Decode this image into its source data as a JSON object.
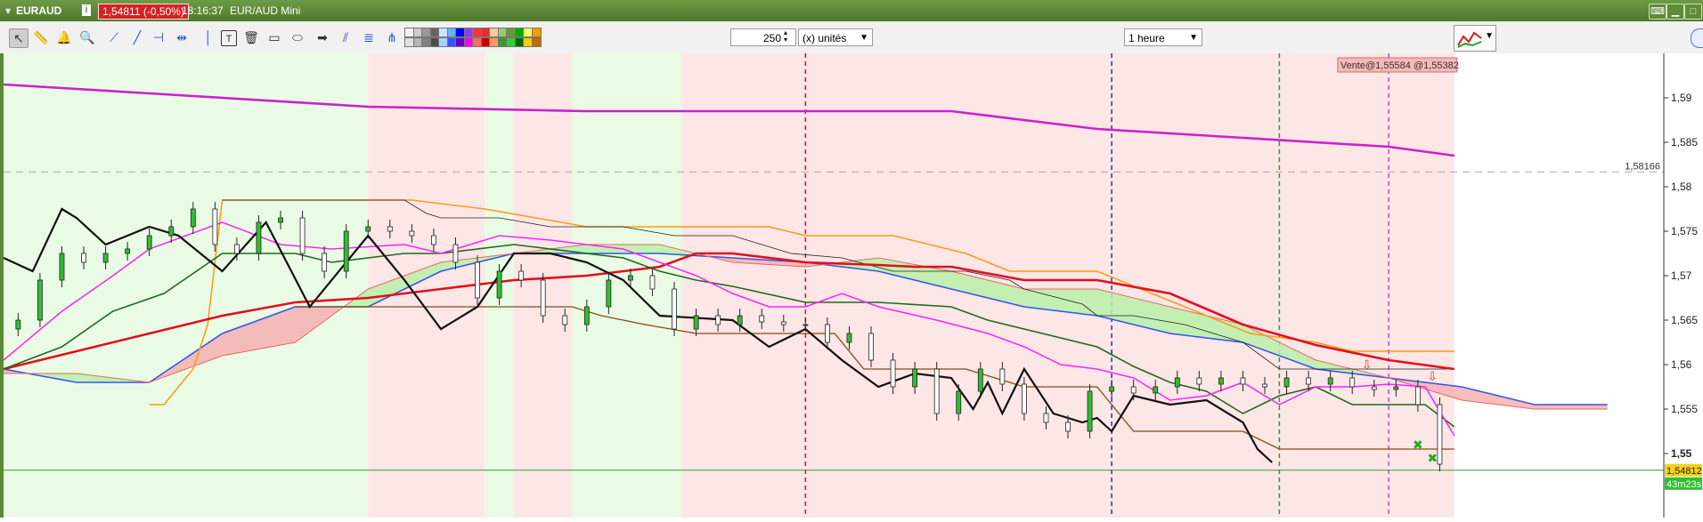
{
  "window": {
    "symbol": "EURAUD",
    "price": "1,54811 (-0,50%)",
    "time": "18:16:37",
    "name": "EUR/AUD Mini",
    "info_icon": "info-icon",
    "menu_icon": "chevron-down-icon"
  },
  "toolbar": {
    "tools": [
      "pointer-icon",
      "ruler-icon",
      "alarm-icon",
      "zoom-icon",
      "trendline-icon",
      "line-icon",
      "horizontal-line-icon",
      "segment-icon",
      "vertical-line-icon",
      "text-icon",
      "trash-icon",
      "rectangle-icon",
      "ellipse-icon",
      "arrow-icon",
      "channel-icon",
      "fibonacci-icon",
      "pitchfork-icon"
    ],
    "units_value": "250",
    "units_label": "(x) unités",
    "timeframe": "1 heure",
    "colors": [
      "#f2f2f2",
      "#e0e0e0",
      "#cccccc",
      "#b3b3b3",
      "#999999",
      "#808080",
      "#666666",
      "#4d4d4d",
      "#cce5ff",
      "#a3d3ff",
      "#66b3ff",
      "#3355ff",
      "#0000ff",
      "#6600cc",
      "#9933ff",
      "#ff00ff",
      "#ff3333",
      "#ff6666",
      "#e03030",
      "#cc0000",
      "#ffcc99",
      "#ff9966",
      "#99cc66",
      "#339933",
      "#669933",
      "#33cc33",
      "#00aa00",
      "#006600",
      "#ffff66",
      "#ffcc00",
      "#ff9900",
      "#cc6600"
    ]
  },
  "chart_data": {
    "type": "line",
    "instrument": "EUR/AUD",
    "timeframe": "1 heure",
    "y_ticks": [
      1.55,
      1.555,
      1.56,
      1.565,
      1.57,
      1.575,
      1.58,
      1.585,
      1.59
    ],
    "y_tick_labels": [
      "1,55",
      "1,555",
      "1,56",
      "1,565",
      "1,57",
      "1,575",
      "1,58",
      "1,585",
      "1,59"
    ],
    "ylim": [
      1.546,
      1.595
    ],
    "x_range": [
      0,
      200
    ],
    "n_candles": 200,
    "last_price": "1,54812",
    "countdown": "43m23s",
    "reference_line": {
      "value": 1.58166,
      "label": "1,58166"
    },
    "trade_label": "Vente@1,55584 @1,55382",
    "sma_magenta": {
      "x": [
        0,
        20,
        50,
        80,
        130,
        150,
        170,
        190,
        199
      ],
      "y": [
        1.5915,
        1.5905,
        1.589,
        1.5885,
        1.5885,
        1.5865,
        1.5855,
        1.5845,
        1.5835
      ]
    },
    "tenkan_magenta": {
      "x": [
        0,
        8,
        15,
        20,
        30,
        38,
        45,
        55,
        60,
        68,
        75,
        85,
        90,
        95,
        100,
        105,
        110,
        115,
        120,
        128,
        135,
        140,
        145,
        150,
        155,
        160,
        165,
        170,
        175,
        180,
        185,
        190,
        195,
        199
      ],
      "y": [
        1.5605,
        1.566,
        1.57,
        1.573,
        1.576,
        1.5735,
        1.573,
        1.5735,
        1.5725,
        1.5745,
        1.574,
        1.573,
        1.5715,
        1.57,
        1.568,
        1.5665,
        1.5665,
        1.568,
        1.5665,
        1.565,
        1.5635,
        1.562,
        1.56,
        1.5595,
        1.5585,
        1.556,
        1.5565,
        1.558,
        1.5555,
        1.5575,
        1.5575,
        1.5578,
        1.5575,
        1.552
      ]
    },
    "kijun_green": {
      "x": [
        0,
        8,
        15,
        22,
        30,
        40,
        45,
        55,
        60,
        70,
        85,
        90,
        95,
        100,
        110,
        120,
        130,
        135,
        140,
        150,
        155,
        160,
        165,
        170,
        175,
        180,
        185,
        190,
        195,
        199
      ],
      "y": [
        1.5595,
        1.562,
        1.566,
        1.568,
        1.5725,
        1.5725,
        1.5715,
        1.5725,
        1.5725,
        1.5735,
        1.572,
        1.5705,
        1.5695,
        1.5688,
        1.567,
        1.567,
        1.5665,
        1.565,
        1.564,
        1.562,
        1.5598,
        1.558,
        1.557,
        1.5545,
        1.5565,
        1.5575,
        1.5555,
        1.5555,
        1.5555,
        1.553
      ]
    },
    "chikou_black": {
      "x": [
        0,
        4,
        8,
        10,
        14,
        20,
        24,
        30,
        36,
        42,
        50,
        55,
        60,
        65,
        70,
        75,
        80,
        85,
        90,
        100,
        105,
        110,
        115,
        120,
        125,
        130,
        133,
        135,
        137,
        140,
        144,
        148,
        150,
        152,
        155,
        160,
        165,
        170,
        172,
        174
      ],
      "y": [
        1.572,
        1.5705,
        1.5775,
        1.5765,
        1.5735,
        1.5755,
        1.5745,
        1.5705,
        1.576,
        1.5665,
        1.5745,
        1.5695,
        1.564,
        1.5665,
        1.5725,
        1.5725,
        1.5715,
        1.5695,
        1.5655,
        1.565,
        1.562,
        1.564,
        1.5605,
        1.5575,
        1.559,
        1.5585,
        1.555,
        1.558,
        1.5545,
        1.5595,
        1.5545,
        1.5535,
        1.554,
        1.5525,
        1.5565,
        1.5555,
        1.556,
        1.5535,
        1.5505,
        1.549
      ]
    },
    "red_ma": {
      "x": [
        0,
        10,
        20,
        30,
        40,
        50,
        60,
        70,
        80,
        90,
        95,
        100,
        110,
        120,
        125,
        130,
        140,
        150,
        160,
        170,
        180,
        190,
        199
      ],
      "y": [
        1.5595,
        1.5615,
        1.5635,
        1.5655,
        1.567,
        1.5675,
        1.5685,
        1.5695,
        1.57,
        1.571,
        1.5725,
        1.5725,
        1.5715,
        1.5712,
        1.571,
        1.571,
        1.5695,
        1.5695,
        1.568,
        1.5645,
        1.5622,
        1.5605,
        1.5595
      ]
    },
    "ssa_red_line": {
      "x": [
        0,
        10,
        20,
        30,
        40,
        50,
        60,
        70,
        80,
        90,
        100,
        110,
        120,
        130,
        140,
        150,
        160,
        170,
        180,
        190,
        200,
        210,
        220
      ],
      "y": [
        1.559,
        1.559,
        1.558,
        1.561,
        1.5625,
        1.5685,
        1.5715,
        1.5725,
        1.5735,
        1.5735,
        1.5715,
        1.571,
        1.572,
        1.5705,
        1.5685,
        1.5685,
        1.5665,
        1.5645,
        1.5605,
        1.5585,
        1.556,
        1.555,
        1.555
      ]
    },
    "ssb_blue_line": {
      "x": [
        0,
        10,
        20,
        30,
        40,
        50,
        60,
        70,
        80,
        90,
        100,
        110,
        120,
        130,
        140,
        150,
        160,
        170,
        180,
        190,
        200,
        210,
        220
      ],
      "y": [
        1.5595,
        1.558,
        1.558,
        1.5635,
        1.5665,
        1.5665,
        1.5705,
        1.5725,
        1.5725,
        1.5725,
        1.572,
        1.5715,
        1.5705,
        1.5685,
        1.5665,
        1.5655,
        1.5635,
        1.5625,
        1.5595,
        1.5585,
        1.5575,
        1.5555,
        1.5555
      ]
    },
    "orange_line": {
      "x": [
        20,
        22,
        24,
        26,
        28,
        30,
        40,
        48,
        56,
        66,
        80,
        90,
        105,
        110,
        122,
        132,
        138,
        150,
        165,
        171,
        180,
        185,
        199
      ],
      "y": [
        1.5555,
        1.5555,
        1.5575,
        1.5595,
        1.5645,
        1.5785,
        1.5785,
        1.5785,
        1.5785,
        1.5775,
        1.5755,
        1.5755,
        1.5755,
        1.5745,
        1.5745,
        1.5725,
        1.5705,
        1.5705,
        1.5655,
        1.5635,
        1.5625,
        1.5615,
        1.5615
      ]
    },
    "black_thin": {
      "x": [
        30,
        40,
        55,
        58,
        60,
        68,
        75,
        85,
        92,
        100,
        108,
        115,
        122,
        128,
        132,
        138,
        140,
        148,
        150,
        155,
        162,
        170,
        175,
        199
      ],
      "y": [
        1.5785,
        1.5785,
        1.5785,
        1.577,
        1.5765,
        1.5765,
        1.5755,
        1.5755,
        1.5745,
        1.5745,
        1.5725,
        1.572,
        1.5705,
        1.5705,
        1.5705,
        1.5695,
        1.5685,
        1.5668,
        1.5655,
        1.5655,
        1.5645,
        1.5625,
        1.5595,
        1.5595
      ]
    },
    "brown_line": {
      "x": [
        40,
        70,
        78,
        82,
        88,
        95,
        100,
        110,
        114,
        118,
        124,
        128,
        132,
        140,
        145,
        150,
        155,
        170,
        175,
        199
      ],
      "y": [
        1.5665,
        1.5665,
        1.5665,
        1.5655,
        1.5645,
        1.5635,
        1.5635,
        1.5635,
        1.5635,
        1.5595,
        1.5595,
        1.5595,
        1.5595,
        1.5575,
        1.5575,
        1.5575,
        1.5525,
        1.5525,
        1.5505,
        1.5505
      ]
    },
    "candles": {
      "x": [
        2,
        5,
        8,
        11,
        14,
        17,
        20,
        23,
        26,
        29,
        32,
        35,
        38,
        41,
        44,
        47,
        50,
        53,
        56,
        59,
        62,
        65,
        68,
        71,
        74,
        77,
        80,
        83,
        86,
        89,
        92,
        95,
        98,
        101,
        104,
        107,
        110,
        113,
        116,
        119,
        122,
        125,
        128,
        131,
        134,
        137,
        140,
        143,
        146,
        149,
        152,
        155,
        158,
        161,
        164,
        167,
        170,
        173,
        176,
        179,
        182,
        185,
        188,
        191,
        194,
        197
      ],
      "close": [
        1.565,
        1.5695,
        1.5725,
        1.5715,
        1.5725,
        1.573,
        1.5745,
        1.5755,
        1.5775,
        1.5735,
        1.5725,
        1.576,
        1.5765,
        1.5725,
        1.5705,
        1.575,
        1.5755,
        1.575,
        1.5745,
        1.5735,
        1.5715,
        1.5675,
        1.5705,
        1.5695,
        1.5655,
        1.5645,
        1.5665,
        1.5695,
        1.57,
        1.5685,
        1.564,
        1.5655,
        1.5645,
        1.5655,
        1.5648,
        1.5645,
        1.5645,
        1.5625,
        1.5635,
        1.5605,
        1.5575,
        1.5595,
        1.5545,
        1.557,
        1.5595,
        1.5578,
        1.5545,
        1.5535,
        1.5525,
        1.557,
        1.5575,
        1.5568,
        1.5575,
        1.5585,
        1.5578,
        1.5585,
        1.5578,
        1.5575,
        1.5585,
        1.5578,
        1.5585,
        1.5575,
        1.5572,
        1.5575,
        1.5555,
        1.5488
      ]
    }
  },
  "axis": {
    "price_label": "1,54812",
    "countdown": "43m23s"
  }
}
